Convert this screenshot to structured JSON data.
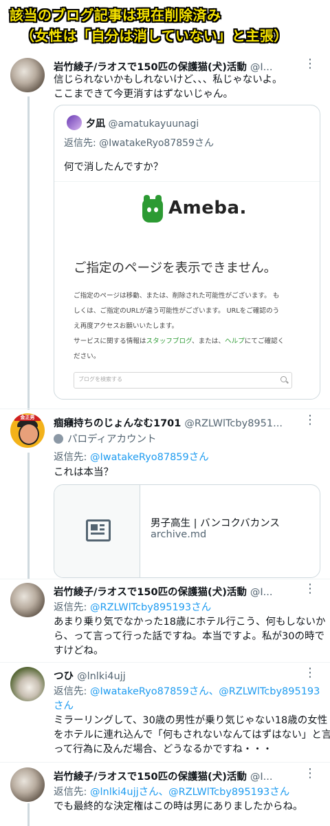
{
  "banner": {
    "line1": "該当のブログ記事は現在削除済み",
    "line2": "（女性は「自分は消していない」と主張）"
  },
  "tweets": [
    {
      "name": "岩竹綾子/ラオスで150匹の保護猫(犬)活動",
      "handle": "@I...",
      "text1": "信じられないかもしれないけど、、、私じゃないよ。",
      "text2": "ここまできて今更消すはずないじゃん。",
      "quote": {
        "name": "夕凪",
        "handle": "@amatukayuunagi",
        "reply_prefix": "返信先: ",
        "reply_to": "@IwatakeRyo87859さん",
        "text": "何で消したんですか？",
        "ameba_word": "Ameba.",
        "error_title": "ご指定のページを表示できません。",
        "error_body1": "ご指定のページは移動、または、削除された可能性がございます。 も",
        "error_body2": "しくは、ご指定のURLが違う可能性がございます。 URLをご確認のう",
        "error_body3": "え再度アクセスお願いいたします。",
        "error_body4_a": "サービスに関する情報は",
        "error_link1": "スタッフブログ",
        "error_body4_b": "、または、",
        "error_link2": "ヘルプ",
        "error_body4_c": "にてご確認く",
        "error_body5": "ださい。",
        "search_placeholder": "ブログを検索する"
      }
    },
    {
      "name": "痼癪持ちのじょんなむ1701",
      "handle": "@RZLWlTcby8951...",
      "avatar_band": "金正男",
      "parody_label": "パロディアカウント",
      "reply_prefix": "返信先: ",
      "reply_to": "@IwatakeRyo87859さん",
      "text1": "これは本当？",
      "link_card": {
        "title": "男子高生 | バンコクバカンス",
        "domain": "archive.md"
      }
    },
    {
      "name": "岩竹綾子/ラオスで150匹の保護猫(犬)活動",
      "handle": "@I...",
      "reply_prefix": "返信先: ",
      "reply_to": "@RZLWlTcby895193さん",
      "text1": "あまり乗り気でなかった18歳にホテル行こう、何もしないか",
      "text2": "ら、って言って行った話ですね。本当ですよ。私が30の時で",
      "text3": "すけどね。"
    },
    {
      "name": "つひ",
      "handle": "@lnlki4ujj",
      "reply_prefix": "返信先: ",
      "reply_to": "@IwatakeRyo87859さん、@RZLWlTcby895193",
      "reply_to2": "さん",
      "text1": "ミラーリングして、30歳の男性が乗り気じゃない18歳の女性",
      "text2": "をホテルに連れ込んで「何もされないなんてはずはない」と言",
      "text3": "って行為に及んだ場合、どうなるかですね・・・"
    },
    {
      "name": "岩竹綾子/ラオスで150匹の保護猫(犬)活動",
      "handle": "@I...",
      "reply_prefix": "返信先: ",
      "reply_to": "@lnlki4ujjさん、@RZLWlTcby895193さん",
      "text1": "でも最終的な決定権はこの時は男にありましたからね。"
    }
  ],
  "colors": {
    "link": "#1d9bf0",
    "muted": "#536471",
    "banner_text": "#f7e400",
    "ameba_green": "#2c9a33"
  }
}
